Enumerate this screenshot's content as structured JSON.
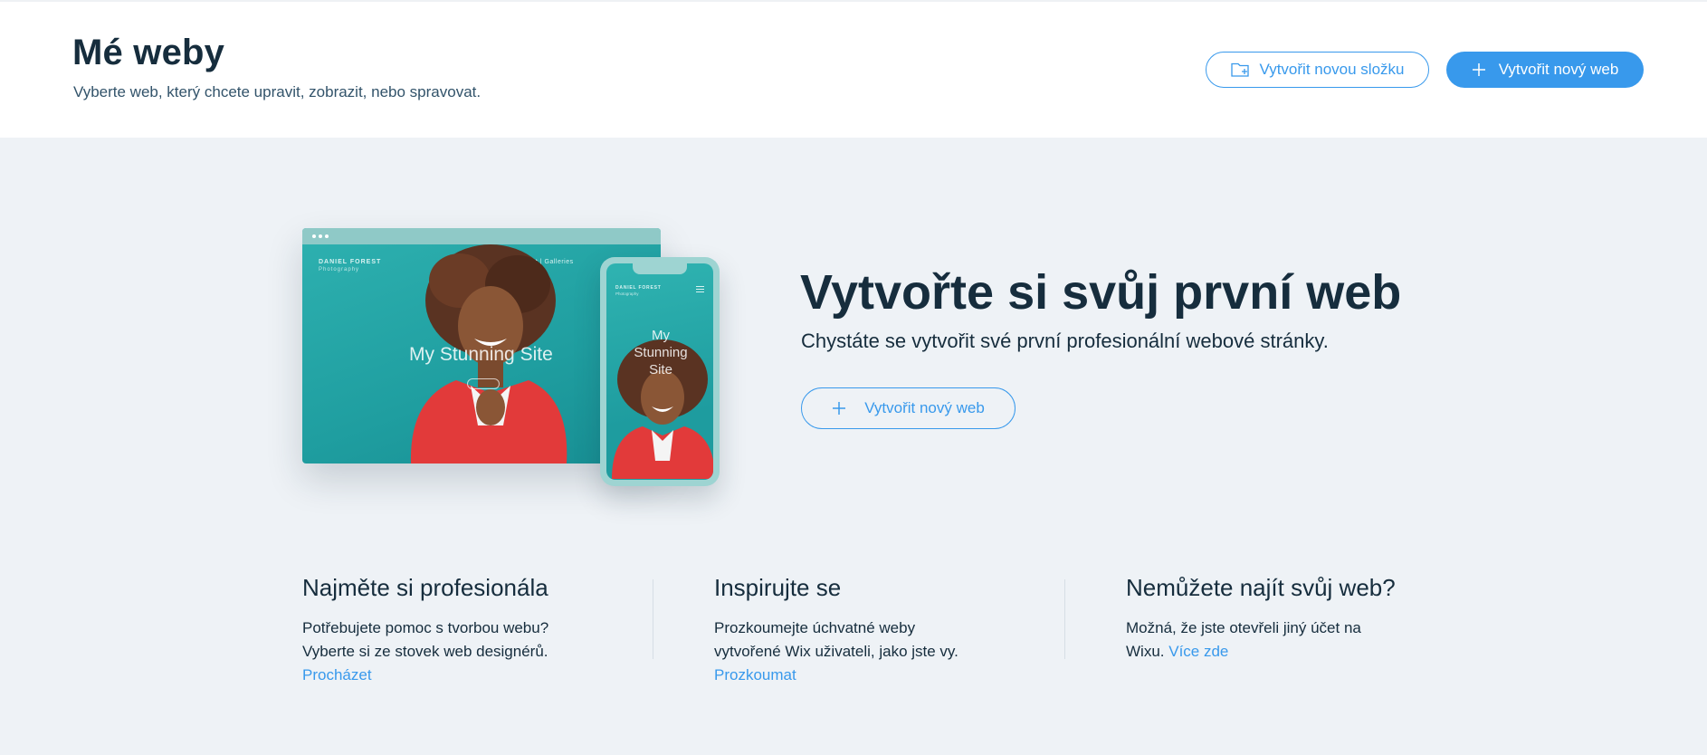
{
  "header": {
    "title": "Mé weby",
    "subtitle": "Vyberte web, který chcete upravit, zobrazit, nebo spravovat.",
    "create_folder_label": "Vytvořit novou složku",
    "create_site_label": "Vytvořit nový web"
  },
  "illustration": {
    "brand": "DANIEL FOREST",
    "brand_sub": "Photography",
    "nav": "Home   |   About   |   Galleries",
    "site_title": "My Stunning Site",
    "phone_site_title": "My Stunning Site"
  },
  "hero": {
    "title": "Vytvořte si svůj první web",
    "subtitle": "Chystáte se vytvořit své první profesionální webové stránky.",
    "button_label": "Vytvořit nový web"
  },
  "columns": [
    {
      "heading": "Najměte si profesionála",
      "text_line1": "Potřebujete pomoc s tvorbou webu?",
      "text_line2": "Vyberte si ze stovek web designérů.",
      "link": "Procházet"
    },
    {
      "heading": "Inspirujte se",
      "text_line1": "Prozkoumejte úchvatné weby",
      "text_line2": "vytvořené Wix uživateli, jako jste vy.",
      "link": "Prozkoumat"
    },
    {
      "heading": "Nemůžete najít svůj web?",
      "text_line1": "Možná, že jste otevřeli jiný účet na",
      "text_prefix": "Wixu.",
      "link": "Více zde"
    }
  ],
  "colors": {
    "accent": "#3899ec",
    "text": "#162d3d",
    "background": "#eef2f6"
  }
}
